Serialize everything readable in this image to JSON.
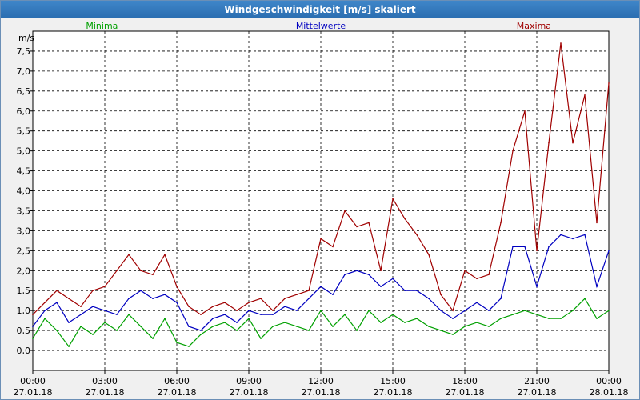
{
  "window": {
    "title": "Windgeschwindigkeit [m/s] skaliert"
  },
  "chart_data": {
    "type": "line",
    "title": "Windgeschwindigkeit [m/s] skaliert",
    "ylabel": "m/s",
    "ylim": [
      -0.5,
      8
    ],
    "yticks": [
      "0,0",
      "0,5",
      "1,0",
      "1,5",
      "2,0",
      "2,5",
      "3,0",
      "3,5",
      "4,0",
      "4,5",
      "5,0",
      "5,5",
      "6,0",
      "6,5",
      "7,0",
      "7,5"
    ],
    "yticks_values": [
      0,
      0.5,
      1,
      1.5,
      2,
      2.5,
      3,
      3.5,
      4,
      4.5,
      5,
      5.5,
      6,
      6.5,
      7,
      7.5
    ],
    "xlim": [
      0,
      24
    ],
    "xticks": [
      {
        "time": "00:00",
        "date": "27.01.18"
      },
      {
        "time": "03:00",
        "date": "27.01.18"
      },
      {
        "time": "06:00",
        "date": "27.01.18"
      },
      {
        "time": "09:00",
        "date": "27.01.18"
      },
      {
        "time": "12:00",
        "date": "27.01.18"
      },
      {
        "time": "15:00",
        "date": "27.01.18"
      },
      {
        "time": "18:00",
        "date": "27.01.18"
      },
      {
        "time": "21:00",
        "date": "27.01.18"
      },
      {
        "time": "00:00",
        "date": "28.01.18"
      }
    ],
    "grid": true,
    "legend_position": "top",
    "series": [
      {
        "name": "Minima",
        "color": "#00a000",
        "x": [
          0,
          0.5,
          1,
          1.5,
          2,
          2.5,
          3,
          3.5,
          4,
          4.5,
          5,
          5.5,
          6,
          6.5,
          7,
          7.5,
          8,
          8.5,
          9,
          9.5,
          10,
          10.5,
          11,
          11.5,
          12,
          12.5,
          13,
          13.5,
          14,
          14.5,
          15,
          15.5,
          16,
          16.5,
          17,
          17.5,
          18,
          18.5,
          19,
          19.5,
          20,
          20.5,
          21,
          21.5,
          22,
          22.5,
          23,
          23.5,
          24
        ],
        "y": [
          0.3,
          0.8,
          0.5,
          0.1,
          0.6,
          0.4,
          0.7,
          0.5,
          0.9,
          0.6,
          0.3,
          0.8,
          0.2,
          0.1,
          0.4,
          0.6,
          0.7,
          0.5,
          0.8,
          0.3,
          0.6,
          0.7,
          0.6,
          0.5,
          1.0,
          0.6,
          0.9,
          0.5,
          1.0,
          0.7,
          0.9,
          0.7,
          0.8,
          0.6,
          0.5,
          0.4,
          0.6,
          0.7,
          0.6,
          0.8,
          0.9,
          1.0,
          0.9,
          0.8,
          0.8,
          1.0,
          1.3,
          0.8,
          1.0
        ]
      },
      {
        "name": "Mittelwerte",
        "color": "#0000c0",
        "x": [
          0,
          0.5,
          1,
          1.5,
          2,
          2.5,
          3,
          3.5,
          4,
          4.5,
          5,
          5.5,
          6,
          6.5,
          7,
          7.5,
          8,
          8.5,
          9,
          9.5,
          10,
          10.5,
          11,
          11.5,
          12,
          12.5,
          13,
          13.5,
          14,
          14.5,
          15,
          15.5,
          16,
          16.5,
          17,
          17.5,
          18,
          18.5,
          19,
          19.5,
          20,
          20.5,
          21,
          21.5,
          22,
          22.5,
          23,
          23.5,
          24
        ],
        "y": [
          0.6,
          1.0,
          1.2,
          0.7,
          0.9,
          1.1,
          1.0,
          0.9,
          1.3,
          1.5,
          1.3,
          1.4,
          1.2,
          0.6,
          0.5,
          0.8,
          0.9,
          0.7,
          1.0,
          0.9,
          0.9,
          1.1,
          1.0,
          1.3,
          1.6,
          1.4,
          1.9,
          2.0,
          1.9,
          1.6,
          1.8,
          1.5,
          1.5,
          1.3,
          1.0,
          0.8,
          1.0,
          1.2,
          1.0,
          1.3,
          2.6,
          2.6,
          1.6,
          2.6,
          2.9,
          2.8,
          2.9,
          1.6,
          2.5
        ]
      },
      {
        "name": "Maxima",
        "color": "#a00000",
        "x": [
          0,
          0.5,
          1,
          1.5,
          2,
          2.5,
          3,
          3.5,
          4,
          4.5,
          5,
          5.5,
          6,
          6.5,
          7,
          7.5,
          8,
          8.5,
          9,
          9.5,
          10,
          10.5,
          11,
          11.5,
          12,
          12.5,
          13,
          13.5,
          14,
          14.5,
          15,
          15.5,
          16,
          16.5,
          17,
          17.5,
          18,
          18.5,
          19,
          19.5,
          20,
          20.5,
          21,
          21.5,
          22,
          22.5,
          23,
          23.5,
          24
        ],
        "y": [
          0.9,
          1.2,
          1.5,
          1.3,
          1.1,
          1.5,
          1.6,
          2.0,
          2.4,
          2.0,
          1.9,
          2.4,
          1.6,
          1.1,
          0.9,
          1.1,
          1.2,
          1.0,
          1.2,
          1.3,
          1.0,
          1.3,
          1.4,
          1.5,
          2.8,
          2.6,
          3.5,
          3.1,
          3.2,
          2.0,
          3.8,
          3.3,
          2.9,
          2.4,
          1.4,
          1.0,
          2.0,
          1.8,
          1.9,
          3.2,
          5.0,
          6.0,
          2.5,
          5.2,
          7.7,
          5.2,
          6.4,
          3.2,
          6.7
        ]
      }
    ]
  }
}
